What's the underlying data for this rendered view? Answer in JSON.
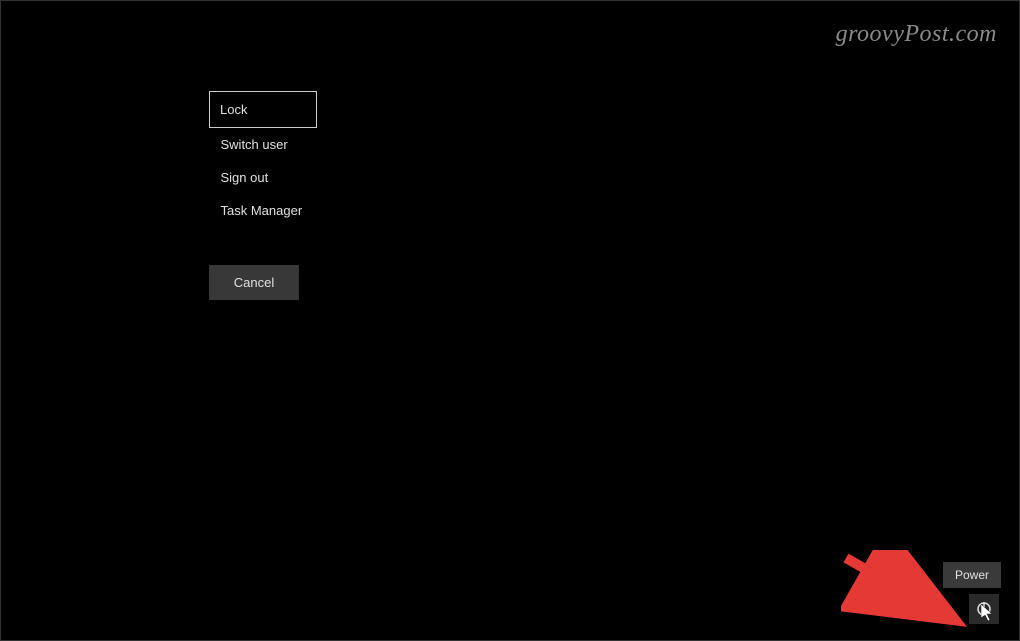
{
  "watermark": "groovyPost.com",
  "menu": {
    "items": [
      {
        "label": "Lock",
        "focused": true
      },
      {
        "label": "Switch user",
        "focused": false
      },
      {
        "label": "Sign out",
        "focused": false
      },
      {
        "label": "Task Manager",
        "focused": false
      }
    ],
    "cancel_label": "Cancel"
  },
  "tooltip": {
    "power_label": "Power"
  },
  "tray": {
    "wifi_icon": "wifi",
    "accessibility_icon": "accessibility",
    "power_icon": "power"
  },
  "annotation": {
    "arrow_color": "#E53935"
  }
}
